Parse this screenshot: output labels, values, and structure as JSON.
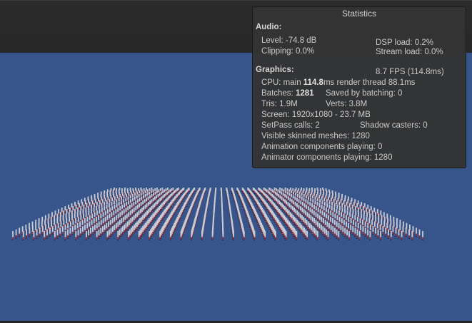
{
  "statistics": {
    "title": "Statistics",
    "audio": {
      "heading": "Audio:",
      "level": "Level: -74.8 dB",
      "clipping": "Clipping: 0.0%",
      "dsp_load": "DSP load: 0.2%",
      "stream_load": "Stream load: 0.0%"
    },
    "graphics": {
      "heading": "Graphics:",
      "fps": "8.7 FPS (114.8ms)",
      "cpu_prefix": "CPU: main ",
      "cpu_main": "114.8",
      "cpu_suffix": "ms  render thread 88.1ms",
      "batches_prefix": "Batches: ",
      "batches": "1281",
      "saved_by_batching": "Saved by batching: 0",
      "tris": "Tris: 1.9M",
      "verts": "Verts: 3.8M",
      "screen": "Screen: 1920x1080 - 23.7 MB",
      "setpass": "SetPass calls: 2",
      "shadow_casters": "Shadow casters: 0",
      "visible_skinned": "Visible skinned meshes: 1280",
      "animation_components": "Animation components playing: 0",
      "animator_components": "Animator components playing: 1280"
    }
  },
  "scene": {
    "background_color": "#37558a",
    "crowd_grid": {
      "columns": 40,
      "rows": 32,
      "total_characters": 1280
    },
    "character_colors": {
      "body": "#c9ccd4",
      "accent": "#9a2e37",
      "shadow": "#1e2a44"
    }
  }
}
